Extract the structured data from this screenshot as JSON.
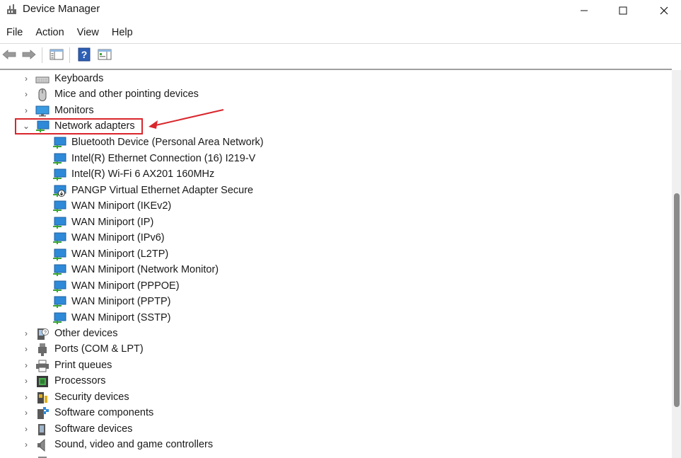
{
  "window": {
    "title": "Device Manager",
    "minimize_icon": "minimize-icon",
    "maximize_icon": "maximize-icon",
    "close_icon": "close-icon"
  },
  "menu": {
    "items": [
      "File",
      "Action",
      "View",
      "Help"
    ]
  },
  "toolbar": {
    "buttons": [
      "back-arrow-icon",
      "forward-arrow-icon",
      "show-hide-console-tree-icon",
      "help-icon",
      "properties-icon"
    ]
  },
  "tree": {
    "categories_before": [
      {
        "label": "Keyboards",
        "icon": "keyboard-icon"
      },
      {
        "label": "Mice and other pointing devices",
        "icon": "mouse-icon"
      },
      {
        "label": "Monitors",
        "icon": "monitor-icon"
      }
    ],
    "expanded": {
      "label": "Network adapters",
      "icon": "network-adapter-icon"
    },
    "children": [
      "Bluetooth Device (Personal Area Network)",
      "Intel(R) Ethernet Connection (16) I219-V",
      "Intel(R) Wi-Fi 6 AX201 160MHz",
      "PANGP Virtual Ethernet Adapter Secure",
      "WAN Miniport (IKEv2)",
      "WAN Miniport (IP)",
      "WAN Miniport (IPv6)",
      "WAN Miniport (L2TP)",
      "WAN Miniport (Network Monitor)",
      "WAN Miniport (PPPOE)",
      "WAN Miniport (PPTP)",
      "WAN Miniport (SSTP)"
    ],
    "categories_after": [
      {
        "label": "Other devices",
        "icon": "other-devices-icon"
      },
      {
        "label": "Ports (COM & LPT)",
        "icon": "port-icon"
      },
      {
        "label": "Print queues",
        "icon": "printer-icon"
      },
      {
        "label": "Processors",
        "icon": "processor-icon"
      },
      {
        "label": "Security devices",
        "icon": "security-device-icon"
      },
      {
        "label": "Software components",
        "icon": "software-component-icon"
      },
      {
        "label": "Software devices",
        "icon": "software-device-icon"
      },
      {
        "label": "Sound, video and game controllers",
        "icon": "speaker-icon"
      }
    ]
  },
  "annotation": {
    "color": "#d9262c"
  },
  "colors": {
    "accent_red": "#d9262c",
    "network_icon_blue": "#2e8ad8",
    "network_icon_green": "#3aa635"
  }
}
